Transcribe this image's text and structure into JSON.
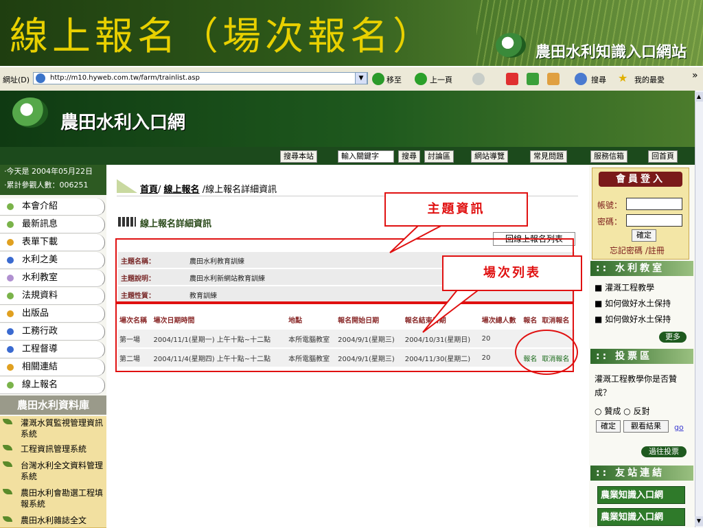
{
  "slide": {
    "title": "線上報名（場次報名）",
    "brand": "農田水利知識入口網站"
  },
  "browser": {
    "address_label": "網址(D)",
    "url": "http://m10.hyweb.com.tw/farm/trainlist.asp",
    "go_label": "移至",
    "back_label": "上一頁",
    "search_label": "搜尋",
    "favorites_label": "我的最愛",
    "more_label": "»"
  },
  "site": {
    "name": "農田水利入口網"
  },
  "nav": {
    "search_site": "搜尋本站",
    "keyword_placeholder": "輸入關鍵字",
    "search_button": "搜尋",
    "items": [
      "討論區",
      "網站導覽",
      "常見問題",
      "服務信箱",
      "回首頁"
    ]
  },
  "left": {
    "today": "‧今天是 2004年05月22日",
    "visits": "‧累計參觀人數：006251",
    "menu": [
      {
        "label": "本會介紹",
        "color": "#7ab34a"
      },
      {
        "label": "最新訊息",
        "color": "#7ab34a"
      },
      {
        "label": "表單下載",
        "color": "#e0a020"
      },
      {
        "label": "水利之美",
        "color": "#3a6ad0"
      },
      {
        "label": "水利教室",
        "color": "#b090d0"
      },
      {
        "label": "法規資料",
        "color": "#7ab34a"
      },
      {
        "label": "出版品",
        "color": "#e0a020"
      },
      {
        "label": "工務行政",
        "color": "#3a6ad0"
      },
      {
        "label": "工程督導",
        "color": "#3a6ad0"
      },
      {
        "label": "相關連結",
        "color": "#e0a020"
      },
      {
        "label": "線上報名",
        "color": "#7ab34a"
      }
    ],
    "db_title": "農田水利資料庫",
    "db_items": [
      "灌溉水質監視管理資訊系統",
      "工程資訊管理系統",
      "台灣水利全文資料管理系統",
      "農田水利會勘選工程填報系統",
      "農田水利雜誌全文"
    ]
  },
  "main": {
    "crumb_home": "首頁",
    "crumb_sep1": "/",
    "crumb_signup": "線上報名",
    "crumb_rest": " /線上報名詳細資訊",
    "section_title": "線上報名詳細資訊",
    "back_to_list": "回線上報名列表",
    "info": [
      {
        "key": "主題名稱：",
        "value": "農田水利教育訓練"
      },
      {
        "key": "主題說明：",
        "value": "農田水利新網站教育訓練"
      },
      {
        "key": "主題性質：",
        "value": "教育訓練"
      }
    ],
    "table": {
      "headers": [
        "場次名稱",
        "場次日期時間",
        "地點",
        "報名開始日期",
        "報名結束日期",
        "場次總人數",
        "報名",
        "取消報名"
      ],
      "rows": [
        [
          "第一場",
          "2004/11/1(星期一) 上午十點~十二點",
          "本所電腦教室",
          "2004/9/1(星期三)",
          "2004/10/31(星期日)",
          "20",
          "",
          ""
        ],
        [
          "第二場",
          "2004/11/4(星期四) 上午十點~十二點",
          "本所電腦教室",
          "2004/9/1(星期三)",
          "2004/11/30(星期二)",
          "20",
          "報名",
          "取消報名"
        ]
      ]
    }
  },
  "annotations": {
    "topic_callout": "主題資訊",
    "session_callout": "場次列表"
  },
  "right": {
    "login_title": "會員登入",
    "account_label": "帳號：",
    "password_label": "密碼：",
    "confirm": "確定",
    "forgot": "忘記密碼 /註冊",
    "classroom_title": "水利教室",
    "classroom_items": [
      "灌溉工程教學",
      "如何做好水土保持",
      "如何做好水土保持"
    ],
    "more": "更多",
    "vote_title": "投票區",
    "vote_question": "灌溉工程教學你是否贊成？",
    "vote_yes": "贊成",
    "vote_no": "反對",
    "vote_confirm": "確定",
    "vote_results": "觀看結果",
    "vote_go": "go",
    "past_votes": "過往投票",
    "friends_title": "友站連結",
    "friend_banner": "農業知識入口網"
  }
}
